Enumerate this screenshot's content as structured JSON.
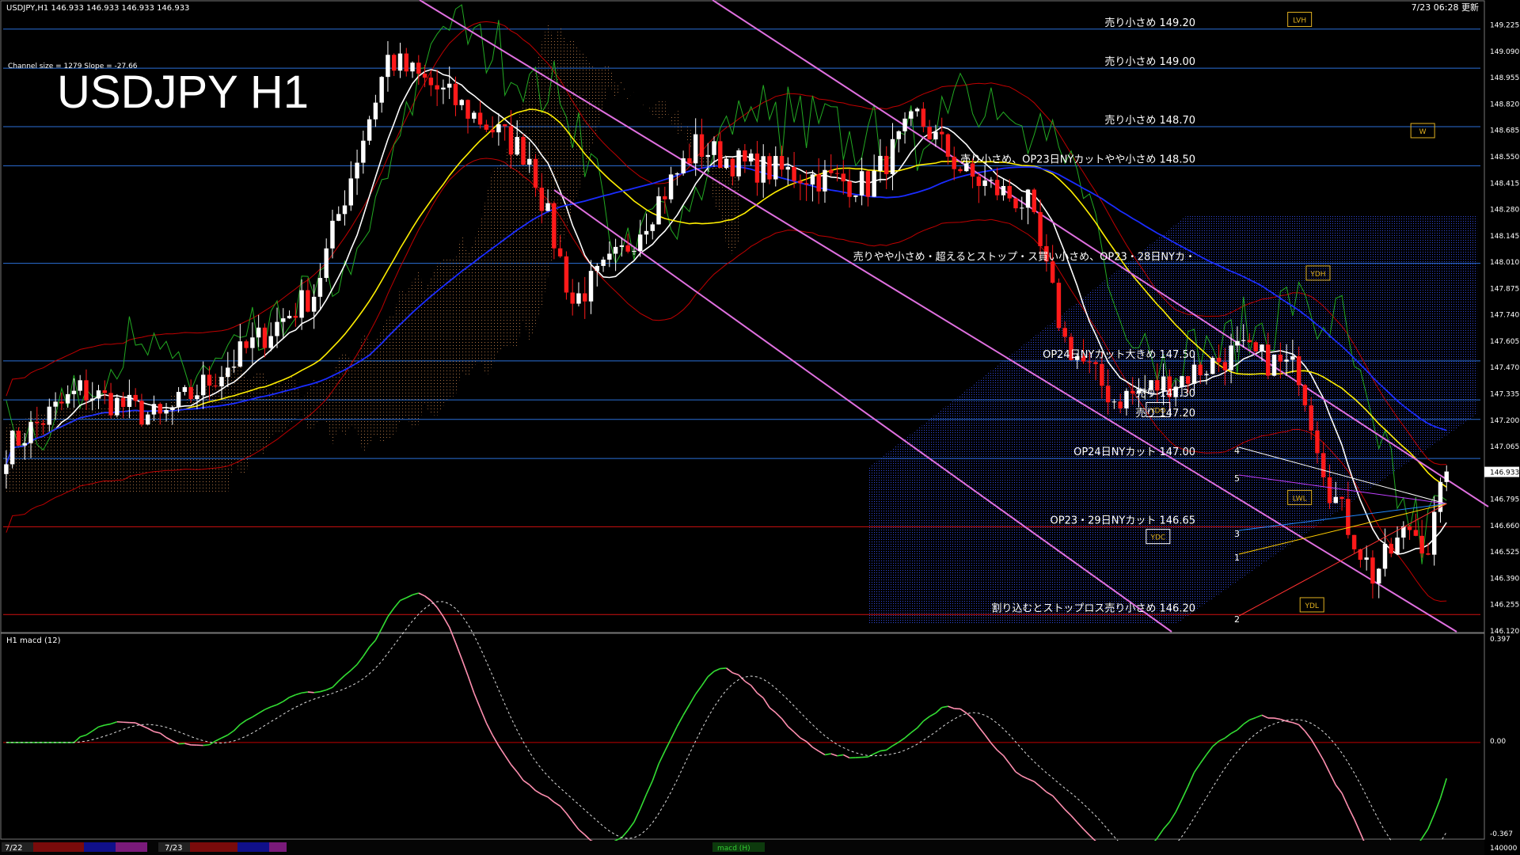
{
  "header": {
    "symbol_info": "USDJPY,H1  146.933 146.933 146.933 146.933",
    "timestamp": "7/23 06:28 更新",
    "channel_info": "Channel size = 1279  Slope = -27.66",
    "big_title": "USDJPY H1"
  },
  "price_axis": {
    "labels": [
      "149.225",
      "149.090",
      "148.955",
      "148.820",
      "148.685",
      "148.550",
      "148.415",
      "148.280",
      "148.145",
      "148.010",
      "147.875",
      "147.740",
      "147.605",
      "147.470",
      "147.335",
      "147.200",
      "147.065",
      "146.933",
      "146.795",
      "146.660",
      "146.525",
      "146.390",
      "146.255",
      "146.120"
    ],
    "current": "146.933"
  },
  "macd_panel": {
    "label": "H1  macd (12)",
    "axis_labels": [
      "0.397",
      "0.00",
      "-0.367"
    ],
    "bottom_right": "140000"
  },
  "level_annotations": [
    {
      "text": "売り小さめ 149.20",
      "price": 149.2,
      "color": "#ffffff"
    },
    {
      "text": "売り小さめ 149.00",
      "price": 149.0,
      "color": "#ffffff"
    },
    {
      "text": "売り小さめ 148.70",
      "price": 148.7,
      "color": "#ffffff"
    },
    {
      "text": "売り小さめ、OP23日NYカットやや小さめ 148.50",
      "price": 148.5,
      "color": "#ffffff"
    },
    {
      "text": "売りやや小さめ・超えるとストップ・ス買い小さめ、OP23・28日NYカ・",
      "price": 148.0,
      "color": "#ffffff"
    },
    {
      "text": "OP24日NYカット大きめ 147.50",
      "price": 147.5,
      "color": "#ffffff"
    },
    {
      "text": "売り 147.30",
      "price": 147.3,
      "color": "#ffffff"
    },
    {
      "text": "売り 147.20",
      "price": 147.2,
      "color": "#ffffff"
    },
    {
      "text": "OP24日NYカット 147.00",
      "price": 147.0,
      "color": "#ffffff"
    },
    {
      "text": "OP23・29日NYカット 146.65",
      "price": 146.65,
      "color": "#ffffff"
    },
    {
      "text": "割り込むとストップロス売り小さめ 146.20",
      "price": 146.2,
      "color": "#ffffff"
    }
  ],
  "box_labels": [
    {
      "text": "LVH",
      "price": 149.25,
      "bar": 210
    },
    {
      "text": "W",
      "price": 148.68,
      "bar": 230
    },
    {
      "text": "YDH",
      "price": 147.95,
      "bar": 213
    },
    {
      "text": "YDO",
      "price": 147.25,
      "bar": 187
    },
    {
      "text": "LWL",
      "price": 146.8,
      "bar": 210
    },
    {
      "text": "YDC",
      "price": 146.6,
      "bar": 187
    },
    {
      "text": "YDL",
      "price": 146.25,
      "bar": 212
    }
  ],
  "projection_numbers": [
    "4",
    "5",
    "3",
    "1",
    "2"
  ],
  "time_axis": {
    "labels": [
      "7/22",
      "7/23"
    ],
    "tab_label": "macd (H)"
  },
  "chart_data": {
    "type": "candlestick",
    "title": "USDJPY H1",
    "y_range": [
      146.12,
      149.26
    ],
    "macd_range": [
      -0.367,
      0.397
    ],
    "n_bars": 240,
    "anchors": [
      [
        0,
        147.05
      ],
      [
        12,
        147.35
      ],
      [
        25,
        147.2
      ],
      [
        35,
        147.45
      ],
      [
        50,
        147.85
      ],
      [
        62,
        149.05
      ],
      [
        72,
        148.85
      ],
      [
        85,
        148.55
      ],
      [
        92,
        147.8
      ],
      [
        100,
        148.05
      ],
      [
        112,
        148.6
      ],
      [
        120,
        148.5
      ],
      [
        130,
        148.45
      ],
      [
        140,
        148.4
      ],
      [
        148,
        148.75
      ],
      [
        156,
        148.45
      ],
      [
        166,
        148.3
      ],
      [
        172,
        147.6
      ],
      [
        180,
        147.3
      ],
      [
        190,
        147.4
      ],
      [
        200,
        147.55
      ],
      [
        210,
        147.45
      ],
      [
        215,
        146.85
      ],
      [
        222,
        146.4
      ],
      [
        228,
        146.65
      ],
      [
        231,
        146.55
      ],
      [
        234,
        146.93
      ]
    ],
    "colors": {
      "bull": "#ffffff",
      "bear": "#ff1a1a",
      "ma_fast": "#ffffff",
      "ma_mid": "#ffee00",
      "ma_slow": "#1a2cff",
      "macd": "#33dd33",
      "macd_neg": "#ff8fb0",
      "signal": "#dddddd"
    }
  }
}
